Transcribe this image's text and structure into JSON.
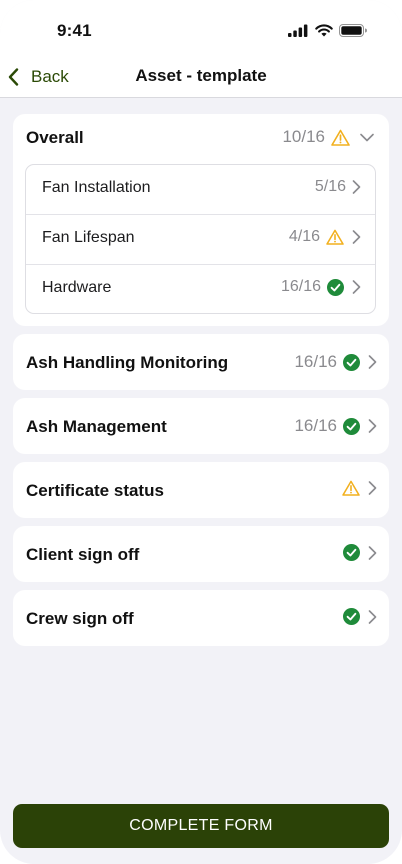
{
  "status_bar": {
    "time": "9:41"
  },
  "nav": {
    "back_label": "Back",
    "title": "Asset - template"
  },
  "overall": {
    "label": "Overall",
    "count": "10/16",
    "status": "warning",
    "items": [
      {
        "label": "Fan Installation",
        "count": "5/16",
        "status": "none"
      },
      {
        "label": "Fan Lifespan",
        "count": "4/16",
        "status": "warning"
      },
      {
        "label": "Hardware",
        "count": "16/16",
        "status": "complete"
      }
    ]
  },
  "sections": [
    {
      "label": "Ash Handling Monitoring",
      "count": "16/16",
      "status": "complete"
    },
    {
      "label": "Ash Management",
      "count": "16/16",
      "status": "complete"
    },
    {
      "label": "Certificate status",
      "count": "",
      "status": "warning"
    },
    {
      "label": "Client sign off",
      "count": "",
      "status": "complete"
    },
    {
      "label": "Crew sign off",
      "count": "",
      "status": "complete"
    }
  ],
  "complete_button": {
    "label": "COMPLETE FORM"
  },
  "colors": {
    "accent": "#2b4207",
    "warning": "#f2b01e",
    "success": "#1f8b3a",
    "background": "#f2f2f7"
  }
}
